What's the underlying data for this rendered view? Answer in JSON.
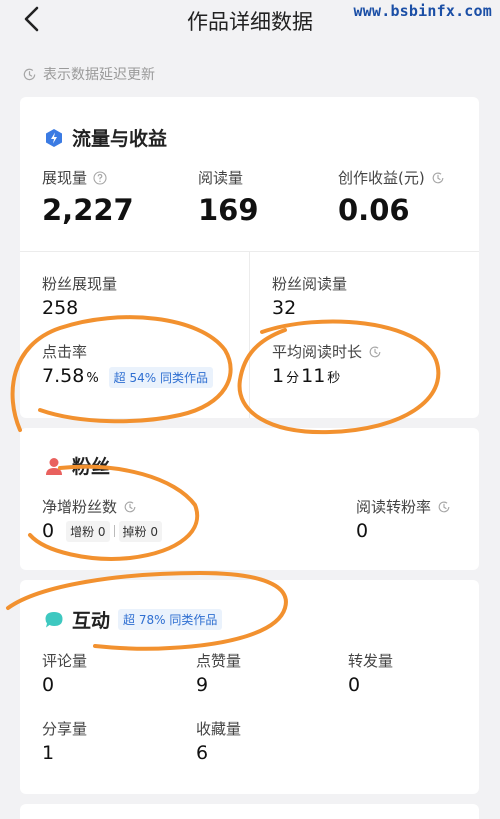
{
  "header": {
    "title": "作品详细数据",
    "watermark": "www.bsbinfx.com"
  },
  "notice": "表示数据延迟更新",
  "traffic": {
    "title": "流量与收益",
    "impressions_label": "展现量",
    "impressions_value": "2,227",
    "reads_label": "阅读量",
    "reads_value": "169",
    "earnings_label": "创作收益(元)",
    "earnings_value": "0.06",
    "fan_impressions_label": "粉丝展现量",
    "fan_impressions_value": "258",
    "fan_reads_label": "粉丝阅读量",
    "fan_reads_value": "32",
    "ctr_label": "点击率",
    "ctr_value": "7.58",
    "ctr_unit": "%",
    "ctr_badge": "超 54% 同类作品",
    "avg_time_label": "平均阅读时长",
    "avg_min": "1",
    "min_unit": "分",
    "avg_sec": "11",
    "sec_unit": "秒"
  },
  "fans": {
    "title": "粉丝",
    "net_label": "净增粉丝数",
    "net_value": "0",
    "gain_label": "增粉 0",
    "loss_label": "掉粉 0",
    "conv_label": "阅读转粉率",
    "conv_value": "0"
  },
  "interact": {
    "title": "互动",
    "badge": "超 78% 同类作品",
    "comments_label": "评论量",
    "comments_value": "0",
    "likes_label": "点赞量",
    "likes_value": "9",
    "reposts_label": "转发量",
    "reposts_value": "0",
    "shares_label": "分享量",
    "shares_value": "1",
    "favorites_label": "收藏量",
    "favorites_value": "6"
  },
  "colors": {
    "accent_blue": "#2f6fd1",
    "annotation_orange": "#f2912f",
    "fans_red": "#e9615e",
    "interact_teal": "#3ec8c0"
  },
  "icons": {
    "back": "chevron-left-icon",
    "delay": "clock-icon",
    "traffic": "lightning-icon",
    "fans": "person-icon",
    "interact": "chat-bubble-icon",
    "help": "question-circle-icon"
  }
}
